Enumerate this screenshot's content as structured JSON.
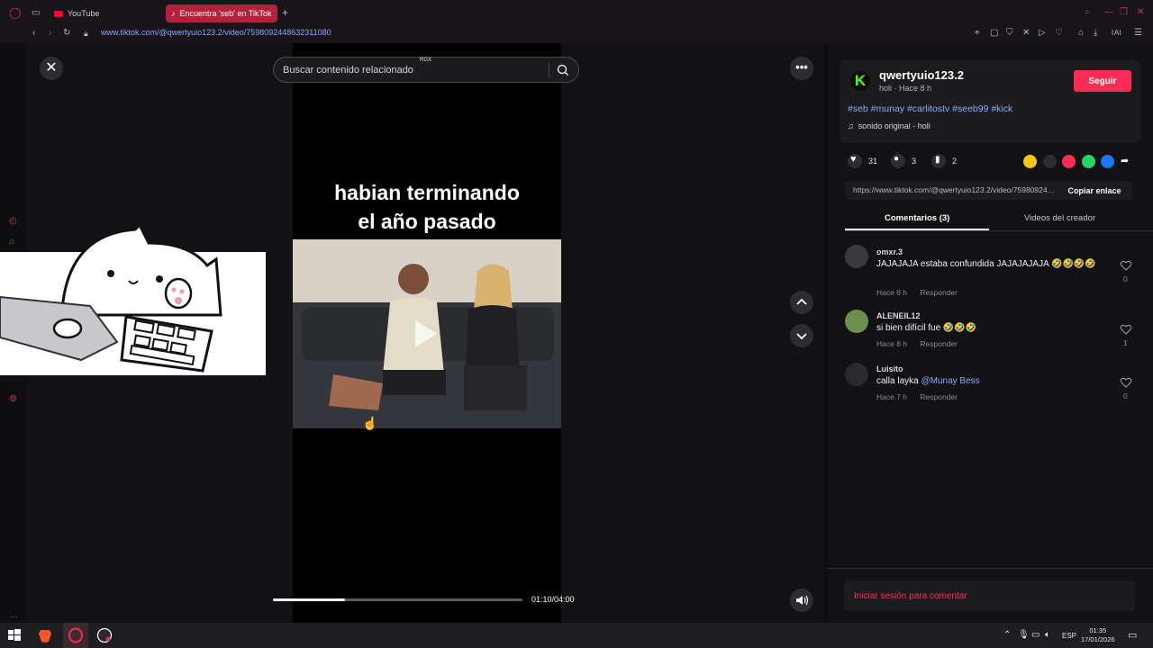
{
  "browser": {
    "tabs": [
      {
        "label": "YouTube",
        "icon": "youtube-icon"
      },
      {
        "label": "Encuentra 'seb' en TikTok",
        "icon": "tiktok-icon"
      }
    ],
    "url": "www.tiktok.com/@qwertyuio123.2/video/7598092448632311080",
    "accent": "#b3213a"
  },
  "player": {
    "search_placeholder": "Buscar contenido relacionado",
    "search_badge": "RGX",
    "caption_line1": "habian terminando",
    "caption_line2": "el año pasado",
    "time": "01:10/04:00",
    "progress": 0.29
  },
  "creator": {
    "username": "qwertyuio123.2",
    "subline": "holi · Hace 8 h",
    "follow_label": "Seguir",
    "hashtags": "#seb #munay #carlitostv #seeb99 #kick",
    "sound": "sonido original - holi",
    "likes": "31",
    "comments": "3",
    "saves": "2",
    "link": "https://www.tiktok.com/@qwertyuio123.2/video/7598092448632311080",
    "copy_label": "Copiar enlace"
  },
  "tabs": {
    "comments": "Comentarios (3)",
    "creator_videos": "Videos del creador"
  },
  "comments": [
    {
      "user": "omxr.3",
      "text": "JAJAJAJA estaba confundida JAJAJAJAJA 🤣🤣🤣🤣",
      "time": "Hace 6 h",
      "reply": "Responder",
      "likes": "0"
    },
    {
      "user": "ALENEIL12",
      "text": "si bien difícil fue 🤣🤣🤣",
      "time": "Hace 8 h",
      "reply": "Responder",
      "likes": "1"
    },
    {
      "user": "Luisito",
      "text": "calla layka ",
      "mention": "@Munay Bess",
      "time": "Hace 7 h",
      "reply": "Responder",
      "likes": "0"
    }
  ],
  "login_prompt": "Iniciar sesión para comentar",
  "taskbar": {
    "lang": "ESP",
    "time": "01:35",
    "date": "17/01/2026"
  },
  "colors": {
    "tiktok_red": "#fe2c55",
    "kick_green": "#53fc18",
    "link_blue": "#8aa7ff"
  }
}
